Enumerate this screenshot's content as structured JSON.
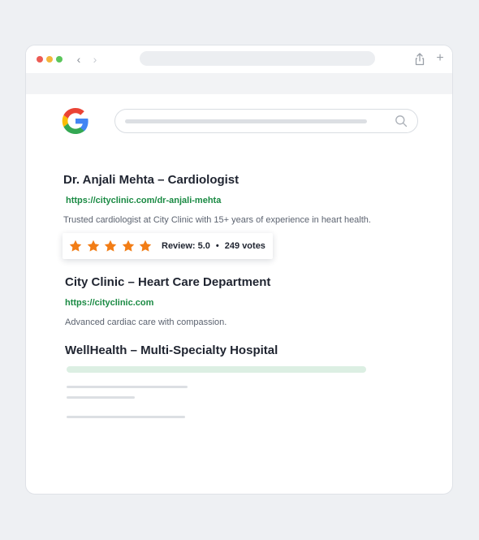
{
  "browser": {
    "back_glyph": "‹",
    "forward_glyph": "›",
    "plus_glyph": "+"
  },
  "results": [
    {
      "title": "Dr. Anjali Mehta – Cardiologist",
      "url": "https://cityclinic.com/dr-anjali-mehta",
      "description": "Trusted cardiologist at City Clinic with 15+ years of experience in heart health.",
      "rating": {
        "stars": 5,
        "review_label": "Review: 5.0",
        "separator": "•",
        "votes": "249 votes"
      }
    },
    {
      "title": "City Clinic – Heart Care Department",
      "url": "https://cityclinic.com",
      "description": "Advanced cardiac care with compassion."
    },
    {
      "title": "WellHealth – Multi-Specialty Hospital"
    }
  ],
  "colors": {
    "url_green": "#1a8a43",
    "star_orange": "#f27d16",
    "background": "#eef0f3"
  }
}
